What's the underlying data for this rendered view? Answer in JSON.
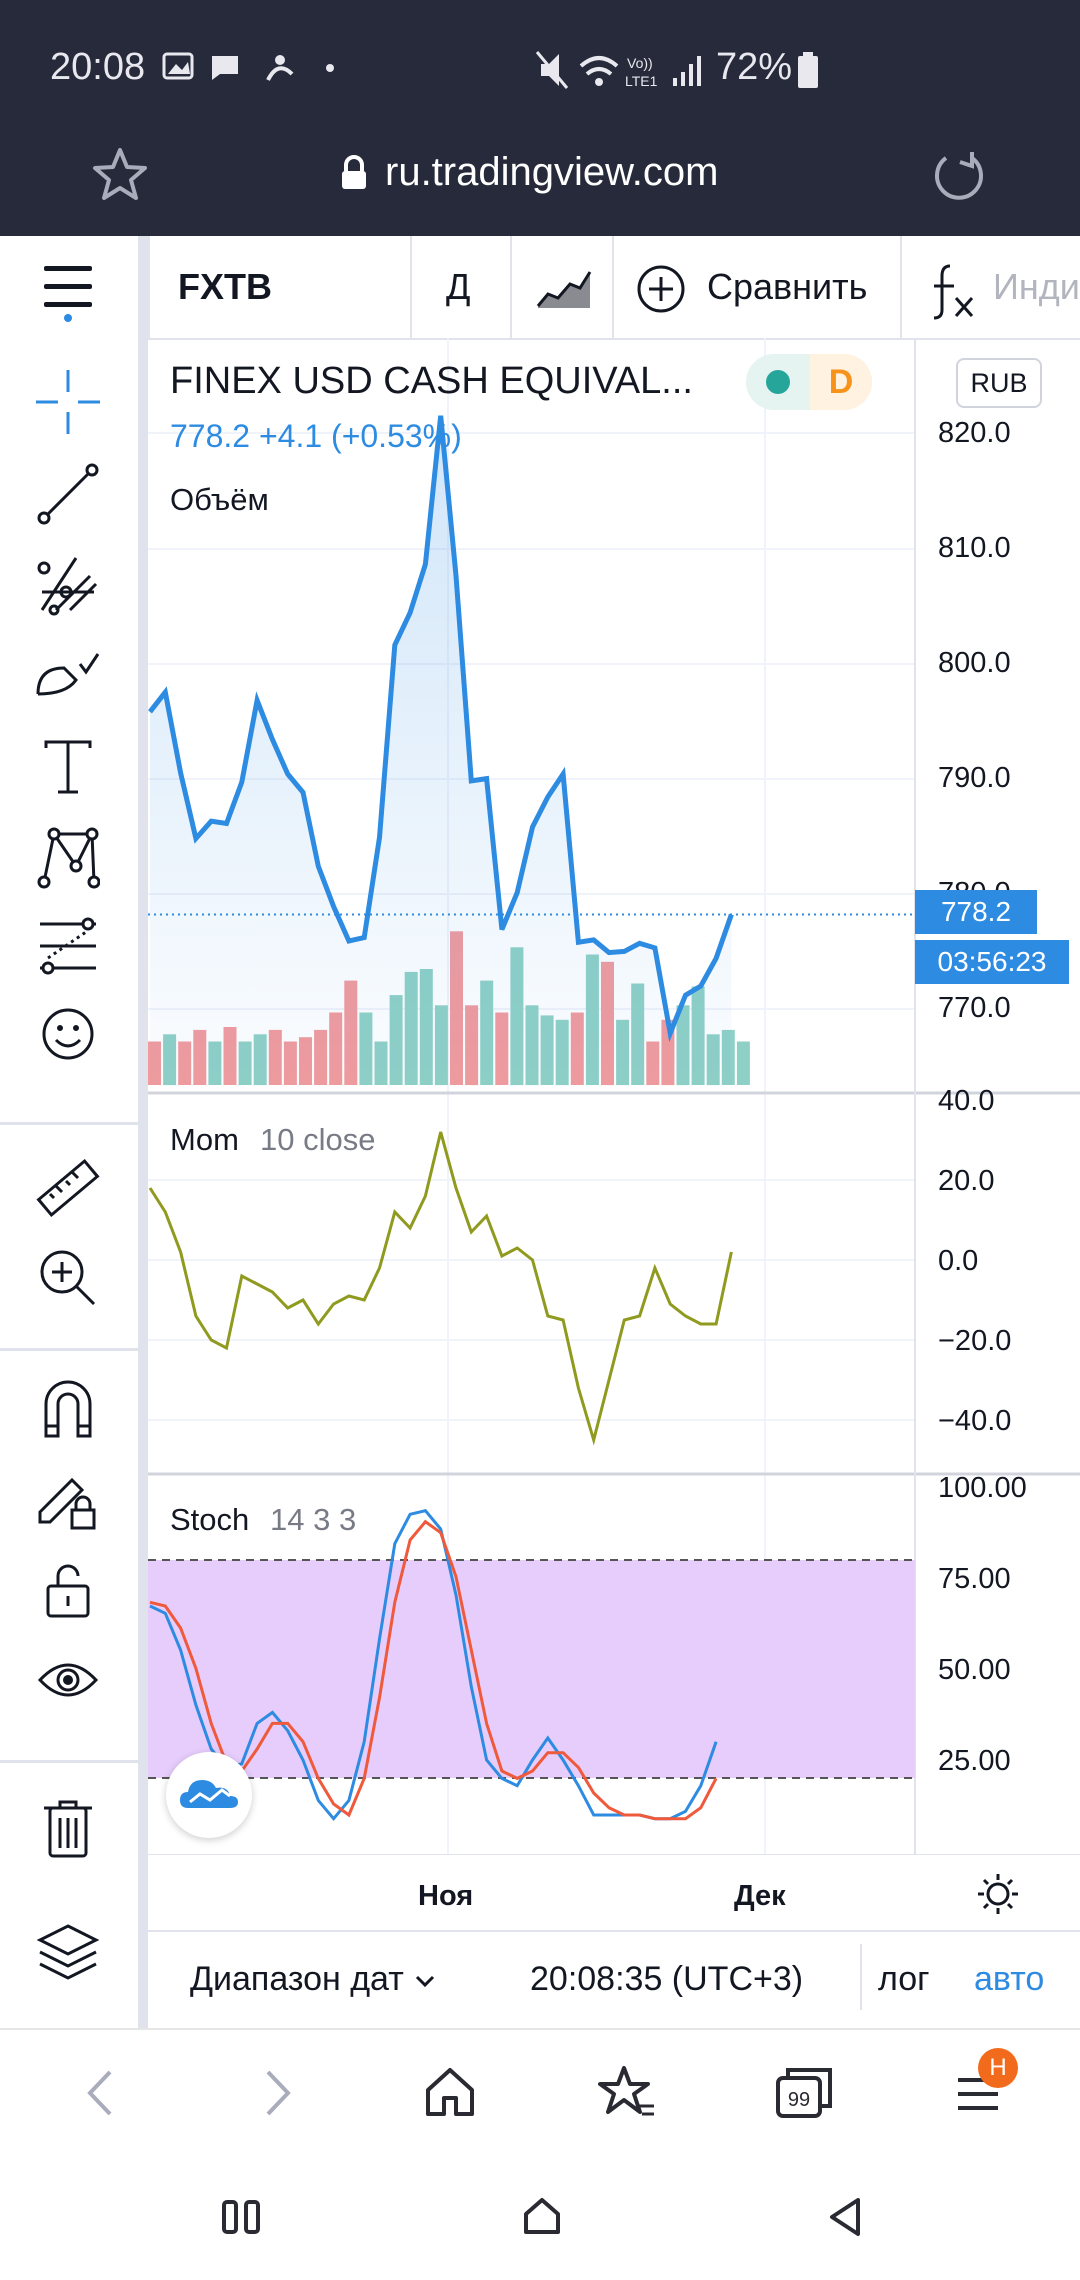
{
  "status_bar": {
    "time": "20:08",
    "battery": "72%",
    "network": "LTE1"
  },
  "browser": {
    "url": "ru.tradingview.com",
    "tabs_count": "99",
    "menu_badge": "H"
  },
  "toolbar": {
    "symbol": "FXTB",
    "interval": "Д",
    "compare_label": "Сравнить",
    "indicators_label": "Инди"
  },
  "chart": {
    "title": "FINEX USD CASH EQUIVAL...",
    "price_line": "778.2  +4.1 (+0.53%)",
    "volume_label": "Объём",
    "currency": "RUB",
    "market_status": "D",
    "last_price": "778.2",
    "countdown": "03:56:23",
    "price_axis": [
      "820.0",
      "810.0",
      "800.0",
      "790.0",
      "780.0",
      "770.0"
    ],
    "x_axis": [
      "Ноя",
      "Дек"
    ],
    "indicators": {
      "mom_name": "Mom",
      "mom_params": "10 close",
      "mom_axis": [
        "40.0",
        "20.0",
        "0.0",
        "−20.0",
        "−40.0"
      ],
      "stoch_name": "Stoch",
      "stoch_params": "14 3 3",
      "stoch_axis": [
        "100.00",
        "75.00",
        "50.00",
        "25.00"
      ]
    }
  },
  "chart_data": [
    {
      "type": "line",
      "title": "FINEX USD CASH EQUIVAL...",
      "series": [
        {
          "name": "FXTB",
          "values": [
            795.8,
            797.5,
            790.5,
            784.8,
            786.3,
            786.1,
            789.7,
            796.8,
            793.4,
            790.4,
            788.8,
            782.4,
            778.9,
            775.9,
            776.2,
            784.9,
            801.6,
            804.4,
            808.6,
            821.5,
            807.6,
            789.8,
            790.0,
            776.9,
            780.1,
            785.8,
            788.4,
            790.4,
            775.8,
            776.0,
            774.9,
            775.0,
            775.7,
            775.3,
            767.9,
            771.2,
            772.0,
            774.4,
            778.2
          ]
        }
      ],
      "ylim": [
        763,
        825
      ]
    },
    {
      "type": "bar",
      "title": "Объём",
      "values": [
        3,
        3.5,
        3,
        3.8,
        3,
        4,
        3,
        3.5,
        3.8,
        3,
        3.3,
        3.8,
        5,
        7.2,
        5,
        3,
        6.2,
        7.8,
        8,
        5.5,
        10.6,
        5.5,
        7.2,
        5,
        9.5,
        5.5,
        4.8,
        4.5,
        5,
        9,
        8.5,
        4.5,
        7,
        3,
        4.5,
        5.5,
        6.8,
        3.5,
        3.8,
        3
      ]
    },
    {
      "type": "line",
      "title": "Mom 10 close",
      "series": [
        {
          "name": "Mom",
          "values": [
            18,
            12,
            2,
            -14,
            -20,
            -22,
            -4,
            -6,
            -8,
            -12,
            -10,
            -16,
            -11,
            -9,
            -10,
            -2,
            12,
            8,
            16,
            32,
            18,
            7,
            11,
            1,
            3,
            0,
            -14,
            -15,
            -32,
            -45,
            -30,
            -15,
            -14,
            -2,
            -11,
            -14,
            -16,
            -16,
            2
          ]
        }
      ],
      "ylim": [
        -50,
        45
      ]
    },
    {
      "type": "line",
      "title": "Stoch 14 3 3",
      "series": [
        {
          "name": "%K",
          "values": [
            67,
            65,
            55,
            40,
            28,
            23,
            24,
            35,
            38,
            33,
            25,
            14,
            9,
            14,
            30,
            58,
            84,
            92,
            93,
            88,
            70,
            45,
            25,
            20,
            18,
            25,
            31,
            25,
            18,
            10,
            10,
            10,
            10,
            9,
            9,
            11,
            18,
            30
          ]
        },
        {
          "name": "%D",
          "values": [
            68,
            67,
            61,
            50,
            35,
            24,
            22,
            28,
            35,
            35,
            30,
            20,
            13,
            10,
            20,
            42,
            68,
            85,
            90,
            87,
            75,
            55,
            35,
            22,
            20,
            22,
            27,
            27,
            23,
            16,
            12,
            10,
            10,
            9,
            9,
            9,
            12,
            20
          ]
        }
      ],
      "ylim": [
        0,
        100
      ],
      "overbought": 80,
      "oversold": 20
    }
  ]
}
